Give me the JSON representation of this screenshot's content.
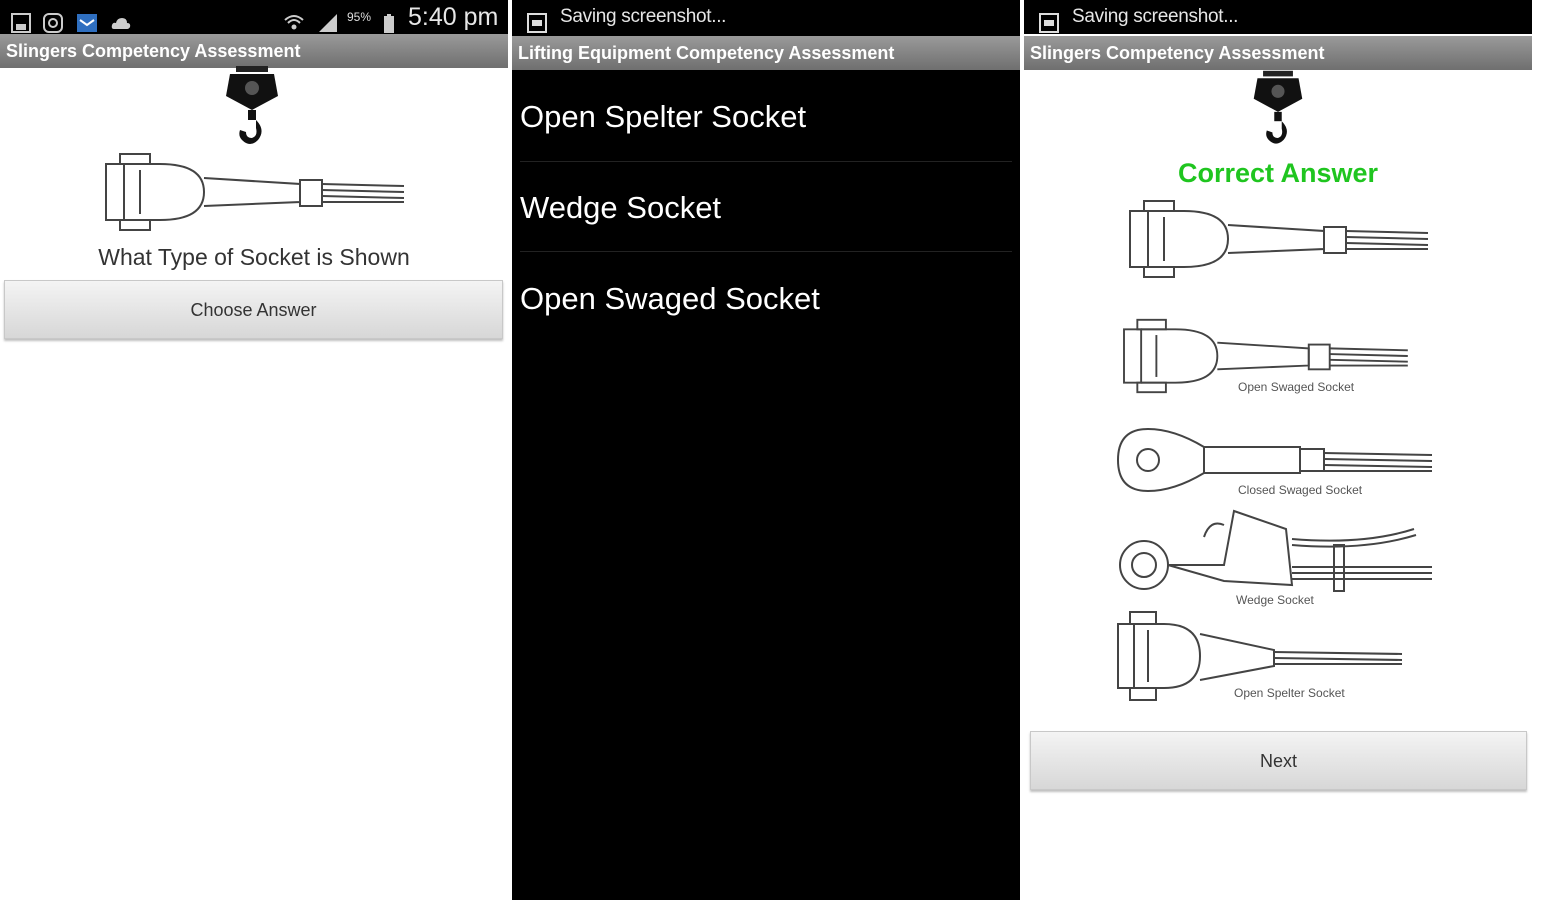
{
  "screens": [
    {
      "status": {
        "battery": "95%",
        "time": "5:40 pm"
      },
      "title": "Slingers Competency Assessment",
      "question": "What Type of Socket is Shown",
      "button": "Choose Answer"
    },
    {
      "status": {
        "notice": "Saving screenshot..."
      },
      "title": "Lifting Equipment Competency Assessment",
      "options": [
        "Open Spelter Socket",
        "Wedge Socket",
        "Open Swaged Socket"
      ]
    },
    {
      "status": {
        "notice": "Saving screenshot..."
      },
      "title": "Slingers Competency Assessment",
      "result": "Correct Answer",
      "captions": [
        "Open Swaged Socket",
        "Closed Swaged Socket",
        "Wedge Socket",
        "Open Spelter Socket"
      ],
      "button": "Next"
    }
  ],
  "colors": {
    "correct": "#1fc51f",
    "titlebar": "#7f7f7f",
    "list_background": "#000000"
  }
}
